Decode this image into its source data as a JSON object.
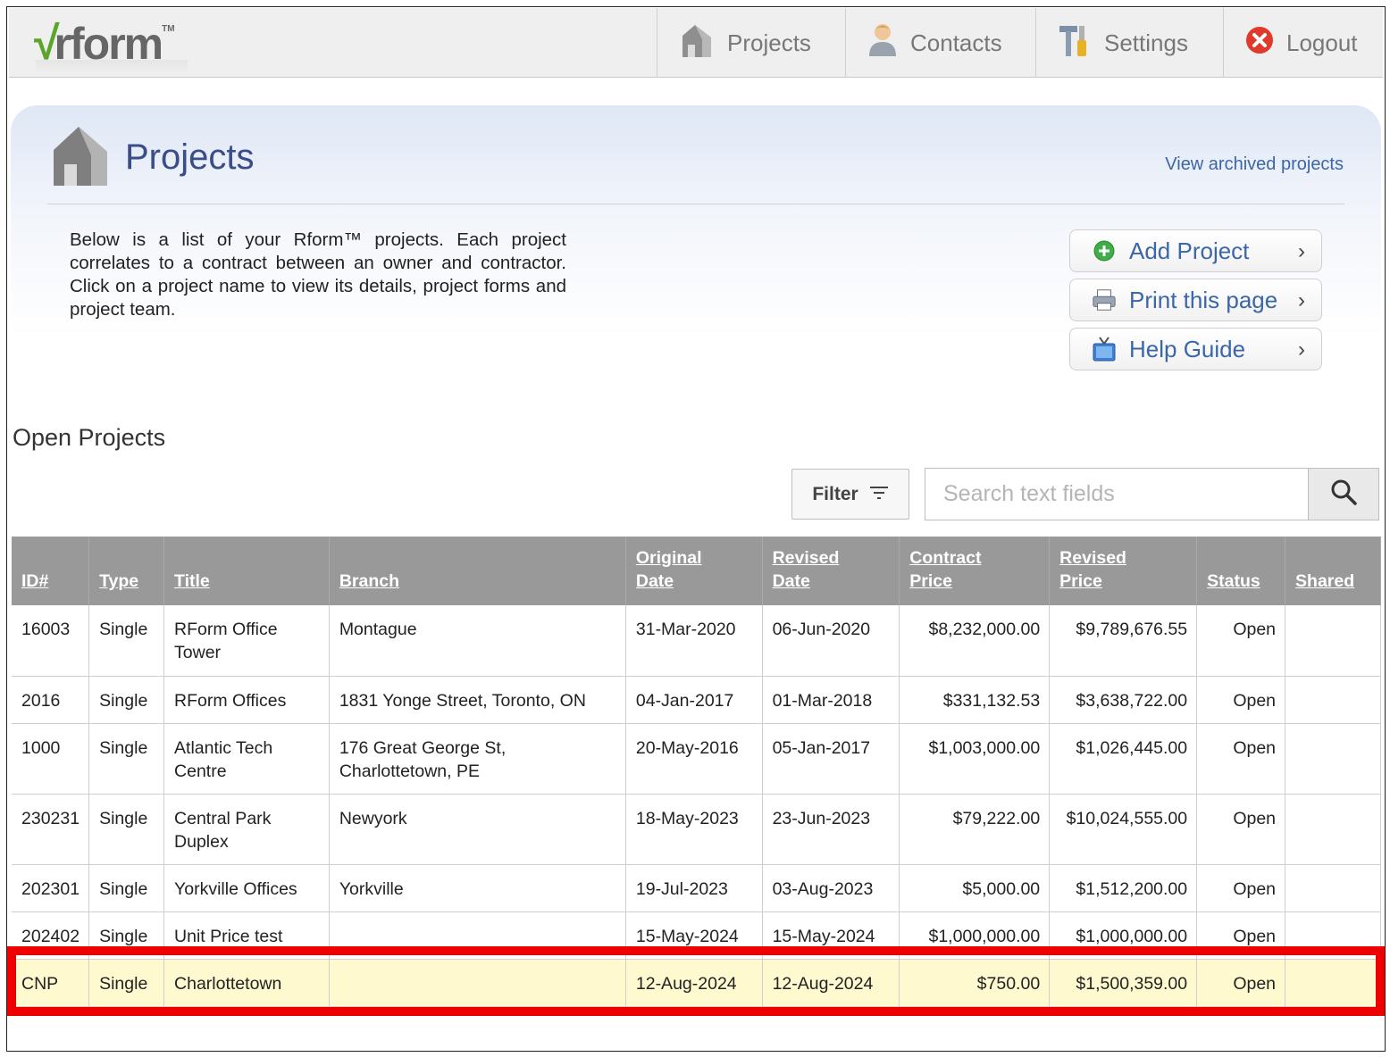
{
  "app": {
    "logo_text": "rform",
    "logo_check": "√",
    "logo_tm": "TM"
  },
  "nav": {
    "projects": "Projects",
    "contacts": "Contacts",
    "settings": "Settings",
    "logout": "Logout"
  },
  "page": {
    "title": "Projects",
    "archived_link": "View archived projects",
    "description": "Below is a list of your Rform™ projects. Each project correlates to a contract between an owner and contractor. Click on a project name to view its details, project forms and project team."
  },
  "actions": {
    "add_project": "Add Project",
    "print_page": "Print this page",
    "help_guide": "Help Guide",
    "chevron": "›"
  },
  "section_title": "Open Projects",
  "filter": {
    "label": "Filter"
  },
  "search": {
    "placeholder": "Search text fields",
    "value": ""
  },
  "table": {
    "headers": {
      "id": "ID#",
      "type": "Type",
      "title": "Title",
      "branch": "Branch",
      "original_date_1": "Original",
      "original_date_2": "Date",
      "revised_date_1": "Revised",
      "revised_date_2": "Date",
      "contract_price_1": "Contract",
      "contract_price_2": "Price",
      "revised_price_1": "Revised",
      "revised_price_2": "Price",
      "status": "Status",
      "shared": "Shared"
    },
    "rows": [
      {
        "id": "16003",
        "type": "Single",
        "title": "RForm Office Tower",
        "branch": "Montague",
        "original_date": "31-Mar-2020",
        "revised_date": "06-Jun-2020",
        "contract_price": "$8,232,000.00",
        "revised_price": "$9,789,676.55",
        "status": "Open",
        "shared": ""
      },
      {
        "id": "2016",
        "type": "Single",
        "title": "RForm Offices",
        "branch": "1831 Yonge Street, Toronto, ON",
        "original_date": "04-Jan-2017",
        "revised_date": "01-Mar-2018",
        "contract_price": "$331,132.53",
        "revised_price": "$3,638,722.00",
        "status": "Open",
        "shared": ""
      },
      {
        "id": "1000",
        "type": "Single",
        "title": "Atlantic Tech Centre",
        "branch": "176 Great George St, Charlottetown, PE",
        "original_date": "20-May-2016",
        "revised_date": "05-Jan-2017",
        "contract_price": "$1,003,000.00",
        "revised_price": "$1,026,445.00",
        "status": "Open",
        "shared": ""
      },
      {
        "id": "230231",
        "type": "Single",
        "title": "Central Park Duplex",
        "branch": "Newyork",
        "original_date": "18-May-2023",
        "revised_date": "23-Jun-2023",
        "contract_price": "$79,222.00",
        "revised_price": "$10,024,555.00",
        "status": "Open",
        "shared": ""
      },
      {
        "id": "202301",
        "type": "Single",
        "title": "Yorkville Offices",
        "branch": "Yorkville",
        "original_date": "19-Jul-2023",
        "revised_date": "03-Aug-2023",
        "contract_price": "$5,000.00",
        "revised_price": "$1,512,200.00",
        "status": "Open",
        "shared": ""
      },
      {
        "id": "202402",
        "type": "Single",
        "title": "Unit Price test",
        "branch": "",
        "original_date": "15-May-2024",
        "revised_date": "15-May-2024",
        "contract_price": "$1,000,000.00",
        "revised_price": "$1,000,000.00",
        "status": "Open",
        "shared": ""
      },
      {
        "id": "CNP",
        "type": "Single",
        "title": "Charlottetown",
        "branch": "",
        "original_date": "12-Aug-2024",
        "revised_date": "12-Aug-2024",
        "contract_price": "$750.00",
        "revised_price": "$1,500,359.00",
        "status": "Open",
        "shared": ""
      }
    ]
  },
  "colors": {
    "header_bg": "#999999",
    "highlight_row": "#fff9cf",
    "highlight_border": "#ee0000",
    "title_blue": "#3b4c8a",
    "link_blue": "#3b66a8"
  }
}
